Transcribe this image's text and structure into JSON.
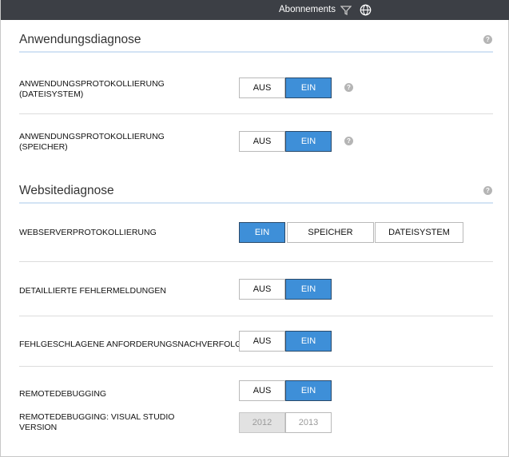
{
  "topbar": {
    "subscriptions_label": "Abonnements",
    "filter_icon": "filter-icon",
    "globe_icon": "globe-icon"
  },
  "app_diag": {
    "title": "Anwendungsdiagnose",
    "help": "?",
    "rows": [
      {
        "label_line1": "ANWENDUNGSPROTOKOLLIERUNG",
        "label_line2": "(DATEISYSTEM)",
        "off": "AUS",
        "on": "EIN",
        "selected": "EIN"
      },
      {
        "label_line1": "ANWENDUNGSPROTOKOLLIERUNG",
        "label_line2": "(SPEICHER)",
        "off": "AUS",
        "on": "EIN",
        "selected": "EIN"
      }
    ]
  },
  "site_diag": {
    "title": "Websitediagnose",
    "help": "?",
    "webserver": {
      "label": "WEBSERVERPROTOKOLLIERUNG",
      "options": [
        "EIN",
        "SPEICHER",
        "DATEISYSTEM"
      ],
      "selected": "EIN"
    },
    "detailed_errors": {
      "label": "DETAILLIERTE FEHLERMELDUNGEN",
      "off": "AUS",
      "on": "EIN",
      "selected": "EIN"
    },
    "failed_requests": {
      "label": "FEHLGESCHLAGENE ANFORDERUNGSNACHVERFOLGUNG",
      "off": "AUS",
      "on": "EIN",
      "selected": "EIN"
    },
    "remote_debugging": {
      "label": "REMOTEDEBUGGING",
      "off": "AUS",
      "on": "EIN",
      "selected": "EIN"
    },
    "vs_version": {
      "label_line1": "REMOTEDEBUGGING: VISUAL STUDIO",
      "label_line2": "VERSION",
      "options": [
        "2012",
        "2013"
      ],
      "selected": "2012",
      "disabled": true
    }
  },
  "colors": {
    "accent": "#3e8fd8",
    "topbar": "#3c3f45",
    "rule": "#d3e3f4"
  }
}
